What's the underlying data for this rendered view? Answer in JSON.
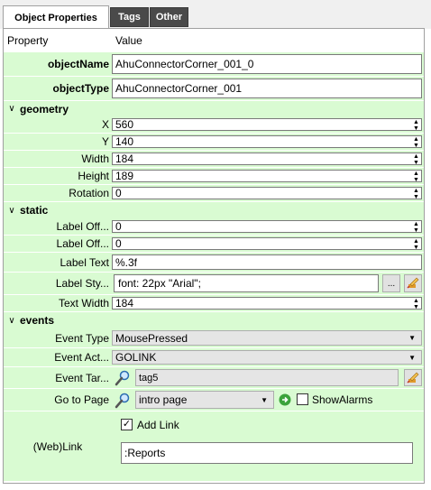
{
  "tabs": [
    "Object Properties",
    "Tags",
    "Other"
  ],
  "header": {
    "property": "Property",
    "value": "Value"
  },
  "rows": {
    "object_name": {
      "label": "objectName",
      "value": "AhuConnectorCorner_001_0"
    },
    "object_type": {
      "label": "objectType",
      "value": "AhuConnectorCorner_001"
    },
    "geometry": {
      "label": "geometry"
    },
    "x": {
      "label": "X",
      "value": "560"
    },
    "y": {
      "label": "Y",
      "value": "140"
    },
    "width": {
      "label": "Width",
      "value": "184"
    },
    "height": {
      "label": "Height",
      "value": "189"
    },
    "rotation": {
      "label": "Rotation",
      "value": "0"
    },
    "static": {
      "label": "static"
    },
    "label_off_1": {
      "label": "Label Off...",
      "value": "0"
    },
    "label_off_2": {
      "label": "Label Off...",
      "value": "0"
    },
    "label_text": {
      "label": "Label Text",
      "value": "%.3f"
    },
    "label_style": {
      "label": "Label Sty...",
      "value": "font: 22px \"Arial\";",
      "button": "..."
    },
    "text_width": {
      "label": "Text Width",
      "value": "184"
    },
    "events": {
      "label": "events"
    },
    "event_type": {
      "label": "Event Type",
      "value": "MousePressed"
    },
    "event_action": {
      "label": "Event Act...",
      "value": "GOLINK"
    },
    "event_target": {
      "label": "Event Tar...",
      "value": "tag5"
    },
    "go_to_page": {
      "label": "Go to Page",
      "value": "intro page",
      "show_alarms": "ShowAlarms",
      "show_alarms_checked": false
    },
    "web_link": {
      "label": "(Web)Link",
      "add_link": "Add Link",
      "add_link_checked": true,
      "value": ":Reports"
    }
  },
  "icons": {
    "chevron": "chevron-down-icon",
    "spin": "spin-arrows-icon",
    "search": "magnifier-icon",
    "edit": "pencil-eraser-icon",
    "goto": "green-arrow-icon"
  }
}
